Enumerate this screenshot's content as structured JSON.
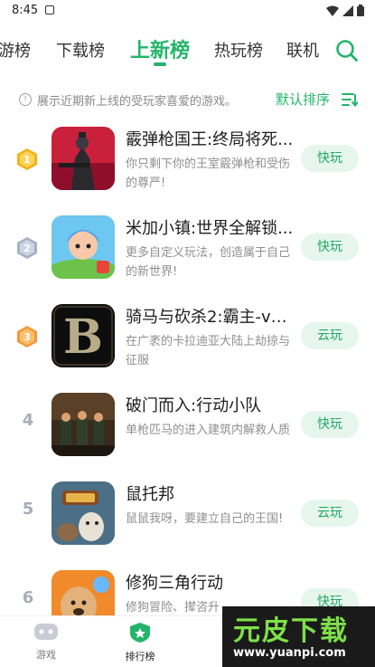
{
  "status_bar": {
    "time": "8:45"
  },
  "tabs": [
    {
      "label": "游榜",
      "active": false
    },
    {
      "label": "下载榜",
      "active": false
    },
    {
      "label": "上新榜",
      "active": true
    },
    {
      "label": "热玩榜",
      "active": false
    },
    {
      "label": "联机",
      "active": false
    }
  ],
  "info": {
    "icon": "info-icon",
    "text": "展示近期新上线的受玩家喜爱的游戏。",
    "sort_label": "默认排序"
  },
  "games": [
    {
      "rank": "1",
      "medal": "gold",
      "title": "霰弹枪国王:终局将死...",
      "desc": "你只剩下你的王室霰弹枪和受伤的尊严!",
      "button": "快玩"
    },
    {
      "rank": "2",
      "medal": "silver",
      "title": "米加小镇:世界全解锁...",
      "desc": "更多自定义玩法，创造属于自己的新世界!",
      "button": "快玩"
    },
    {
      "rank": "3",
      "medal": "bronze",
      "title": "骑马与砍杀2:霸主-v1....",
      "desc": "在广袤的卡拉迪亚大陆上劫掠与征服",
      "button": "云玩"
    },
    {
      "rank": "4",
      "medal": "",
      "title": "破门而入:行动小队",
      "desc": "单枪匹马的进入建筑内解救人质",
      "button": "快玩"
    },
    {
      "rank": "5",
      "medal": "",
      "title": "鼠托邦",
      "desc": "鼠鼠我呀，要建立自己的王国!",
      "button": "云玩"
    },
    {
      "rank": "6",
      "medal": "",
      "title": "修狗三角行动",
      "desc": "修狗冒险、撵咨升",
      "button": "快玩"
    }
  ],
  "bottom_nav": [
    {
      "label": "游戏",
      "icon": "gamepad-icon",
      "active": false
    },
    {
      "label": "排行榜",
      "icon": "ranking-shield-icon",
      "active": true
    }
  ],
  "watermark": {
    "big": "元皮下载",
    "url": "www.yuanpi.com"
  },
  "colors": {
    "accent": "#22b56a",
    "button_bg": "#e6f6ed",
    "gold": "#f2b21a",
    "silver": "#a7b0c4",
    "bronze": "#f19a3e"
  }
}
